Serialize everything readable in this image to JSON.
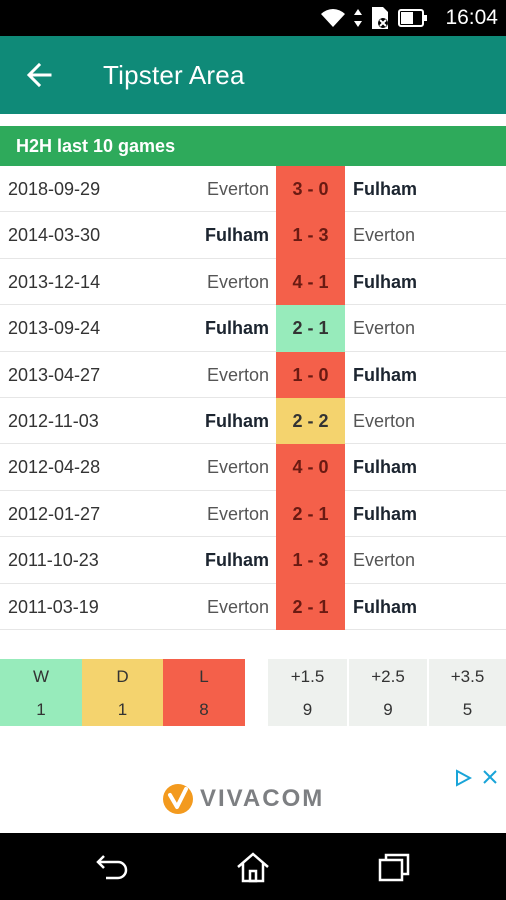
{
  "status_bar": {
    "time": "16:04"
  },
  "app_bar": {
    "title": "Tipster Area"
  },
  "section": {
    "title": "H2H last 10 games"
  },
  "games": [
    {
      "date": "2018-09-29",
      "home": "Everton",
      "score": "3 - 0",
      "away": "Fulham"
    },
    {
      "date": "2014-03-30",
      "home": "Fulham",
      "score": "1 - 3",
      "away": "Everton"
    },
    {
      "date": "2013-12-14",
      "home": "Everton",
      "score": "4 - 1",
      "away": "Fulham"
    },
    {
      "date": "2013-09-24",
      "home": "Fulham",
      "score": "2 - 1",
      "away": "Everton"
    },
    {
      "date": "2013-04-27",
      "home": "Everton",
      "score": "1 - 0",
      "away": "Fulham"
    },
    {
      "date": "2012-11-03",
      "home": "Fulham",
      "score": "2 - 2",
      "away": "Everton"
    },
    {
      "date": "2012-04-28",
      "home": "Everton",
      "score": "4 - 0",
      "away": "Fulham"
    },
    {
      "date": "2012-01-27",
      "home": "Everton",
      "score": "2 - 1",
      "away": "Fulham"
    },
    {
      "date": "2011-10-23",
      "home": "Fulham",
      "score": "1 - 3",
      "away": "Everton"
    },
    {
      "date": "2011-03-19",
      "home": "Everton",
      "score": "2 - 1",
      "away": "Fulham"
    }
  ],
  "result_colors": {
    "win": "#97ebbb",
    "draw": "#f4d36e",
    "loss": "#f4604a"
  },
  "summary": {
    "wdl": [
      {
        "label": "W",
        "value": "1",
        "color": "#97ebbb"
      },
      {
        "label": "D",
        "value": "1",
        "color": "#f4d36e"
      },
      {
        "label": "L",
        "value": "8",
        "color": "#f4604a"
      }
    ],
    "over": [
      {
        "label": "+1.5",
        "value": "9"
      },
      {
        "label": "+2.5",
        "value": "9"
      },
      {
        "label": "+3.5",
        "value": "5"
      }
    ]
  },
  "ad": {
    "brand": "VIVACOM"
  }
}
